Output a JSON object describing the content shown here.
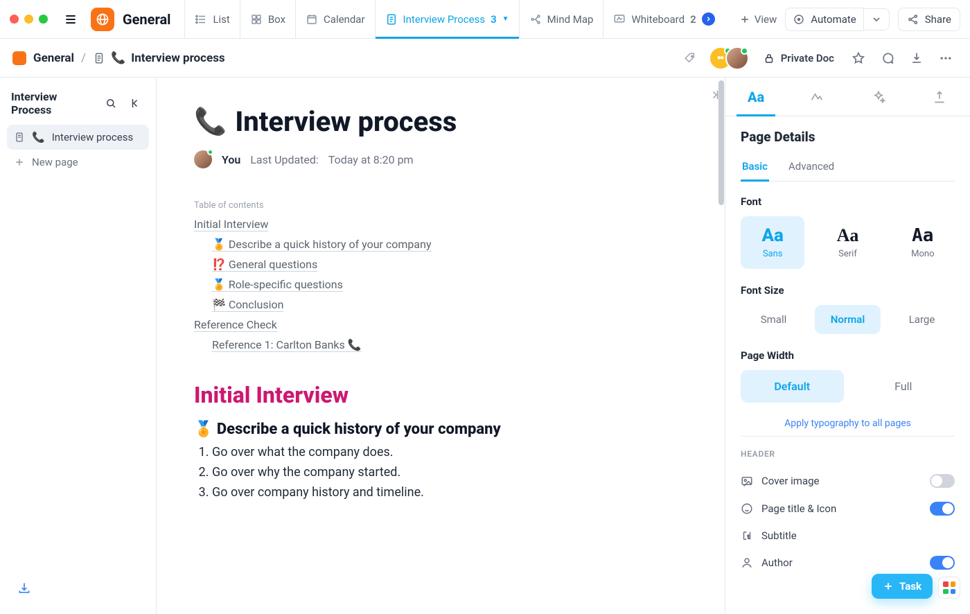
{
  "brand": {
    "name": "General"
  },
  "views": {
    "list": "List",
    "box": "Box",
    "calendar": "Calendar",
    "interview": {
      "label": "Interview Process",
      "count": "3"
    },
    "mindmap": "Mind Map",
    "whiteboard": {
      "label": "Whiteboard",
      "count": "2"
    },
    "addView": "View"
  },
  "topright": {
    "automate": "Automate",
    "share": "Share"
  },
  "breadcrumb": {
    "root": "General",
    "pageIcon": "📞",
    "page": "Interview process",
    "privacy": "Private Doc"
  },
  "sidebar": {
    "title": "Interview Process",
    "items": [
      {
        "icon": "doc",
        "emoji": "📞",
        "label": "Interview process",
        "selected": true
      }
    ],
    "newPage": "New page"
  },
  "doc": {
    "titleEmoji": "📞",
    "title": "Interview process",
    "author": "You",
    "updatedLabel": "Last Updated:",
    "updatedValue": "Today at 8:20 pm",
    "tocLabel": "Table of contents",
    "toc": [
      {
        "lvl": 1,
        "text": "Initial Interview"
      },
      {
        "lvl": 2,
        "text": "🏅 Describe a quick history of your company"
      },
      {
        "lvl": 2,
        "text": "⁉️ General questions"
      },
      {
        "lvl": 2,
        "text": "🏅 Role-specific questions"
      },
      {
        "lvl": 2,
        "text": "🏁 Conclusion"
      },
      {
        "lvl": 1,
        "text": "Reference Check"
      },
      {
        "lvl": 2,
        "text": "Reference 1: Carlton Banks 📞"
      }
    ],
    "h2": "Initial Interview",
    "h3": "🏅 Describe a quick history of your company",
    "ol": [
      "Go over what the company does.",
      "Go over why the company started.",
      "Go over company history and timeline."
    ]
  },
  "panel": {
    "title": "Page Details",
    "subtabs": {
      "basic": "Basic",
      "advanced": "Advanced"
    },
    "fontLabel": "Font",
    "fonts": {
      "sans": "Sans",
      "serif": "Serif",
      "mono": "Mono"
    },
    "fontSizeLabel": "Font Size",
    "sizes": {
      "small": "Small",
      "normal": "Normal",
      "large": "Large"
    },
    "widthLabel": "Page Width",
    "widths": {
      "def": "Default",
      "full": "Full"
    },
    "applyAll": "Apply typography to all pages",
    "headerLabel": "HEADER",
    "headerRows": {
      "cover": "Cover image",
      "titleIcon": "Page title & Icon",
      "subtitle": "Subtitle",
      "author": "Author"
    }
  },
  "fab": {
    "task": "Task"
  }
}
